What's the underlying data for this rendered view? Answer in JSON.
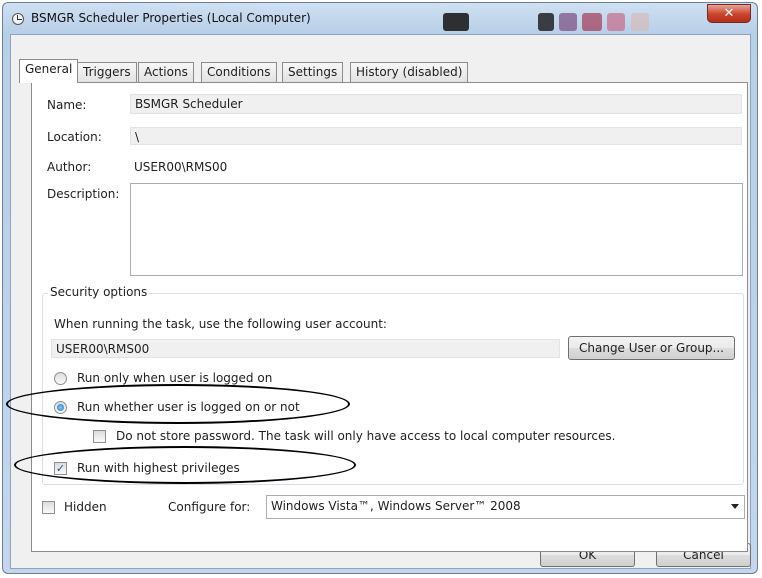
{
  "window": {
    "title": "BSMGR Scheduler Properties (Local Computer)",
    "close_glyph": "✕"
  },
  "tabs": [
    {
      "label": "General"
    },
    {
      "label": "Triggers"
    },
    {
      "label": "Actions"
    },
    {
      "label": "Conditions"
    },
    {
      "label": "Settings"
    },
    {
      "label": "History (disabled)"
    }
  ],
  "general": {
    "name_label": "Name:",
    "name_value": "BSMGR Scheduler",
    "location_label": "Location:",
    "location_value": "\\",
    "author_label": "Author:",
    "author_value": "USER00\\RMS00",
    "description_label": "Description:",
    "description_value": ""
  },
  "security": {
    "title": "Security options",
    "account_prompt": "When running the task, use the following user account:",
    "account_value": "USER00\\RMS00",
    "change_button": "Change User or Group...",
    "radio_logged_on": "Run only when user is logged on",
    "radio_whether": "Run whether user is logged on or not",
    "no_store_password": "Do not store password.  The task will only have access to local computer resources.",
    "highest_privileges": "Run with highest privileges",
    "radio_logged_on_selected": false,
    "radio_whether_selected": true,
    "no_store_password_checked": false,
    "highest_privileges_checked": true
  },
  "footer": {
    "hidden_label": "Hidden",
    "hidden_checked": false,
    "configure_label": "Configure for:",
    "configure_value": "Windows Vista™, Windows Server™ 2008",
    "ok_button": "OK",
    "cancel_button": "Cancel"
  },
  "check_glyph": "✓",
  "colors": {
    "titlebar": "#c3d6ec",
    "close_button": "#c9442c",
    "annotation": "#000000"
  }
}
